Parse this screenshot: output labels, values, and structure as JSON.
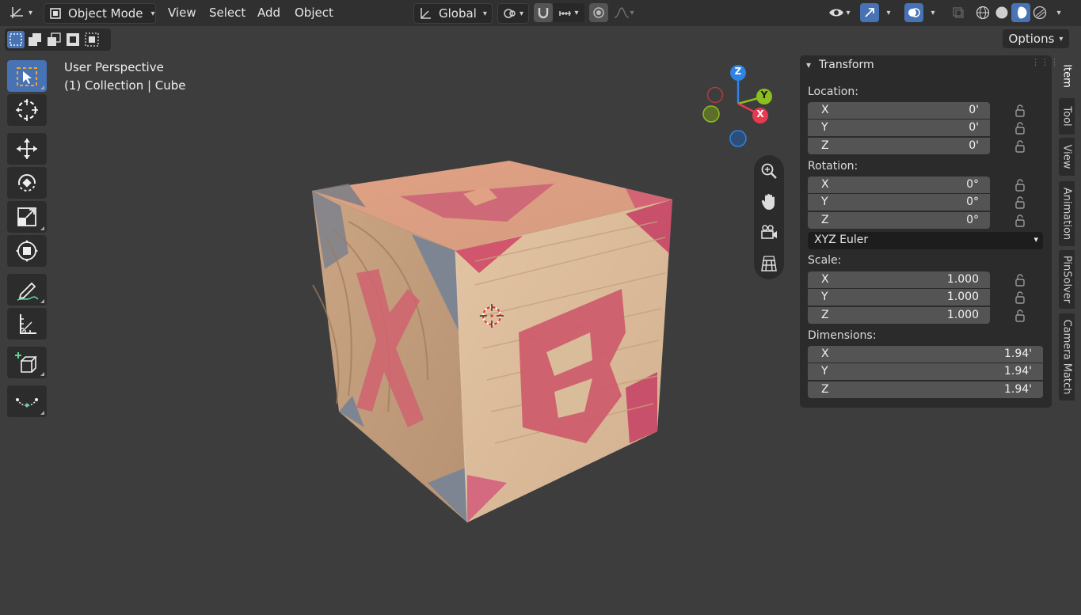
{
  "header": {
    "mode": "Object Mode",
    "menus": [
      "View",
      "Select",
      "Add",
      "Object"
    ],
    "orientation": "Global"
  },
  "toolbar_options": "Options",
  "viewport": {
    "view_name": "User Perspective",
    "collection_line": "(1) Collection | Cube"
  },
  "gizmo": {
    "axes": [
      "Z",
      "Y",
      "X"
    ],
    "colors": {
      "x": "#e8394f",
      "y": "#8bbf1f",
      "z": "#2f83e4"
    }
  },
  "nav_icons": [
    "zoom-icon",
    "hand-pan-icon",
    "camera-icon",
    "grid-icon"
  ],
  "panel": {
    "title": "Transform",
    "location_label": "Location:",
    "location": [
      {
        "axis": "X",
        "value": "0'"
      },
      {
        "axis": "Y",
        "value": "0'"
      },
      {
        "axis": "Z",
        "value": "0'"
      }
    ],
    "rotation_label": "Rotation:",
    "rotation": [
      {
        "axis": "X",
        "value": "0°"
      },
      {
        "axis": "Y",
        "value": "0°"
      },
      {
        "axis": "Z",
        "value": "0°"
      }
    ],
    "rotation_mode": "XYZ Euler",
    "scale_label": "Scale:",
    "scale": [
      {
        "axis": "X",
        "value": "1.000"
      },
      {
        "axis": "Y",
        "value": "1.000"
      },
      {
        "axis": "Z",
        "value": "1.000"
      }
    ],
    "dimensions_label": "Dimensions:",
    "dimensions": [
      {
        "axis": "X",
        "value": "1.94'"
      },
      {
        "axis": "Y",
        "value": "1.94'"
      },
      {
        "axis": "Z",
        "value": "1.94'"
      }
    ]
  },
  "side_tabs": [
    "Item",
    "Tool",
    "View",
    "Animation",
    "PinSolver",
    "Camera Match"
  ],
  "cube_letters": {
    "top": "A",
    "left": "X",
    "right": "B"
  },
  "colors": {
    "accent": "#4772b3",
    "viewport_bg": "#3d3d3d"
  }
}
